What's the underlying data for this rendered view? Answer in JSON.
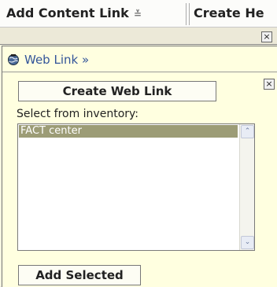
{
  "toolbar": {
    "add_content_link_label": "Add Content Link",
    "add_content_link_chevron": "≚",
    "create_label": "Create He"
  },
  "outer_window": {
    "close_glyph": "×"
  },
  "web_link_panel": {
    "header_label": "Web Link »",
    "header_icon": "globe-icon",
    "close_glyph": "×",
    "create_button_label": "Create Web Link",
    "select_label": "Select from inventory:",
    "inventory_items": [
      "FACT center"
    ],
    "scroll_up_glyph": "⌃",
    "scroll_down_glyph": "⌄",
    "add_selected_label": "Add Selected"
  },
  "colors": {
    "panel_background": "#ffffe0",
    "selected_item": "#9c9c76",
    "header_text": "#335599"
  }
}
